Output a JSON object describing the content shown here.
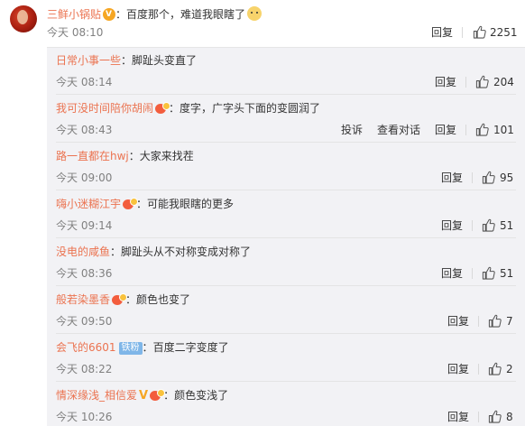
{
  "top": {
    "username": "三鲜小锅贴",
    "colon": "：",
    "text": "百度那个，难道我眼瞎了",
    "time": "今天 08:10",
    "reply": "回复",
    "likes": "2251"
  },
  "replies": [
    {
      "username": "日常小事一些",
      "text": "脚趾头变直了",
      "time": "今天 08:14",
      "actions": [
        "回复"
      ],
      "likes": "204",
      "badge": ""
    },
    {
      "username": "我可没时间陪你胡闹",
      "text": "度字，广字头下面的变圆润了",
      "time": "今天 08:43",
      "actions": [
        "投诉",
        "查看对话",
        "回复"
      ],
      "likes": "101",
      "badge": "crown"
    },
    {
      "username": "路一直都在hwj",
      "text": "大家来找茬",
      "time": "今天 09:00",
      "actions": [
        "回复"
      ],
      "likes": "95",
      "badge": ""
    },
    {
      "username": "嗨小迷糊江宇",
      "text": "可能我眼瞎的更多",
      "time": "今天 09:14",
      "actions": [
        "回复"
      ],
      "likes": "51",
      "badge": "crown"
    },
    {
      "username": "没电的咸鱼",
      "text": "脚趾头从不对称变成对称了",
      "time": "今天 08:36",
      "actions": [
        "回复"
      ],
      "likes": "51",
      "badge": ""
    },
    {
      "username": "般若染墨香",
      "text": "颜色也变了",
      "time": "今天 09:50",
      "actions": [
        "回复"
      ],
      "likes": "7",
      "badge": "crown"
    },
    {
      "username": "会飞的6601",
      "text": "百度二字变度了",
      "time": "今天 08:22",
      "actions": [
        "回复"
      ],
      "likes": "2",
      "badge": "tiefen",
      "badge_text": "铁粉"
    },
    {
      "username": "情深缘浅_相信爱",
      "text": "颜色变浅了",
      "time": "今天 10:26",
      "actions": [
        "回复"
      ],
      "likes": "8",
      "badge": "gold-v-crown",
      "badge_text": "V"
    }
  ],
  "colors": {
    "username": "#eb7350",
    "meta": "#808080",
    "reply_bg": "#f2f2f5"
  },
  "icons": [
    "thumb-up-icon",
    "dog-emoji-icon",
    "crown-badge-icon",
    "v-badge-icon"
  ]
}
